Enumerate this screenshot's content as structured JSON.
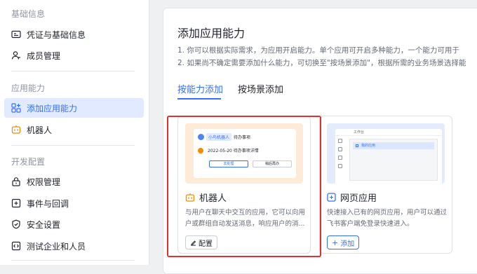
{
  "sidebar": {
    "group1": "基础信息",
    "items1": [
      {
        "label": "凭证与基础信息"
      },
      {
        "label": "成员管理"
      }
    ],
    "group2": "应用能力",
    "items2": [
      {
        "label": "添加应用能力"
      },
      {
        "label": "机器人"
      }
    ],
    "group3": "开发配置",
    "items3": [
      {
        "label": "权限管理"
      },
      {
        "label": "事件与回调"
      },
      {
        "label": "安全设置"
      },
      {
        "label": "测试企业和人员"
      }
    ]
  },
  "main": {
    "title": "添加应用能力",
    "desc1": "1. 你可以根据实际需求，为应用开启能力。单个应用可开启多种能力，一个能力可用于",
    "desc2": "2. 如果尚不确定需要添加什么能力，可切换至\"按场景添加\"，根据所需的业务场景选择能",
    "tabs": [
      {
        "label": "按能力添加"
      },
      {
        "label": "按场景添加"
      }
    ]
  },
  "cards": [
    {
      "title": "机器人",
      "desc": "与用户在聊天中交互的应用，它可以向用户或群组自动发送消息，响应用户的消...",
      "button": "配置",
      "preview": {
        "name": "小鸟机器人",
        "tag": "待办事项",
        "line": "2022-05-20 待办事项详情",
        "btn1": "去处理",
        "btn2": "稍后再办"
      }
    },
    {
      "title": "网页应用",
      "desc": "快速接入已有的网页应用，用户可以通过飞书客户端免登录快速进入。",
      "button": "添加",
      "preview": {
        "app": "工作台",
        "item": "我的应用"
      }
    }
  ],
  "colors": {
    "accent": "#3370ff",
    "highlight": "#e03131",
    "bot_orange": "#f58c00"
  }
}
